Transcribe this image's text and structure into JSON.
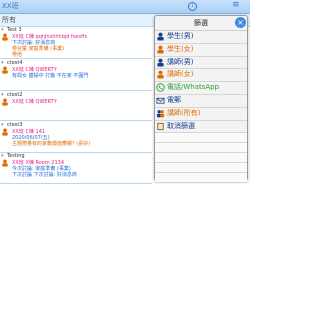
{
  "topbar": {
    "title": "XX班",
    "info_icon": "i",
    "more_icon": "≡"
  },
  "search": {
    "label": "所有"
  },
  "entries": [
    {
      "name": "Test 3",
      "lines": [
        "XX班 C棟 qqhjhshhhbjd fsesffs",
        "下次討論: 好消息商",
        "帶兒童 家庭準備 (事業)",
        "帶他"
      ]
    },
    {
      "name": "ctest4",
      "lines": [
        "XX班 C棟 QWERTY",
        "有興女 體操中 打籠 不在家 不圓門"
      ]
    },
    {
      "name": "ctest2",
      "lines": [
        "XX班 C棟 QWERTY"
      ]
    },
    {
      "name": "ctest3",
      "lines": [
        "XX班 C棟 141",
        "2020/06/07(五)",
        "主題際量有的家教價值應親? (喜好)"
      ]
    },
    {
      "name": "Testing",
      "lines": [
        "XX班 X棟 Room 2134",
        "今次討論: 家庭準備 (事業)",
        "下次討論 下次討論: 好消息商"
      ]
    }
  ],
  "popup": {
    "title": "篩選",
    "close": "×",
    "options": [
      {
        "label": "學生(男)",
        "color": "#1a3d8f",
        "icon": "student-male-icon"
      },
      {
        "label": "學生(女)",
        "color": "#e06c00",
        "icon": "student-female-icon"
      },
      {
        "label": "講師(男)",
        "color": "#1a3d8f",
        "icon": "teacher-male-icon"
      },
      {
        "label": "講師(女)",
        "color": "#e06c00",
        "icon": "teacher-female-icon"
      },
      {
        "label": "電話/WhatsApp",
        "color": "#2e9e2e",
        "icon": "phone-icon"
      },
      {
        "label": "電郵",
        "color": "#1a3d8f",
        "icon": "email-icon"
      },
      {
        "label": "講師(所有)",
        "color": "#e06c00",
        "icon": "teacher-all-icon"
      },
      {
        "label": "取消篩選",
        "color": "#1a3d8f",
        "icon": "clear-filter-icon"
      }
    ]
  }
}
